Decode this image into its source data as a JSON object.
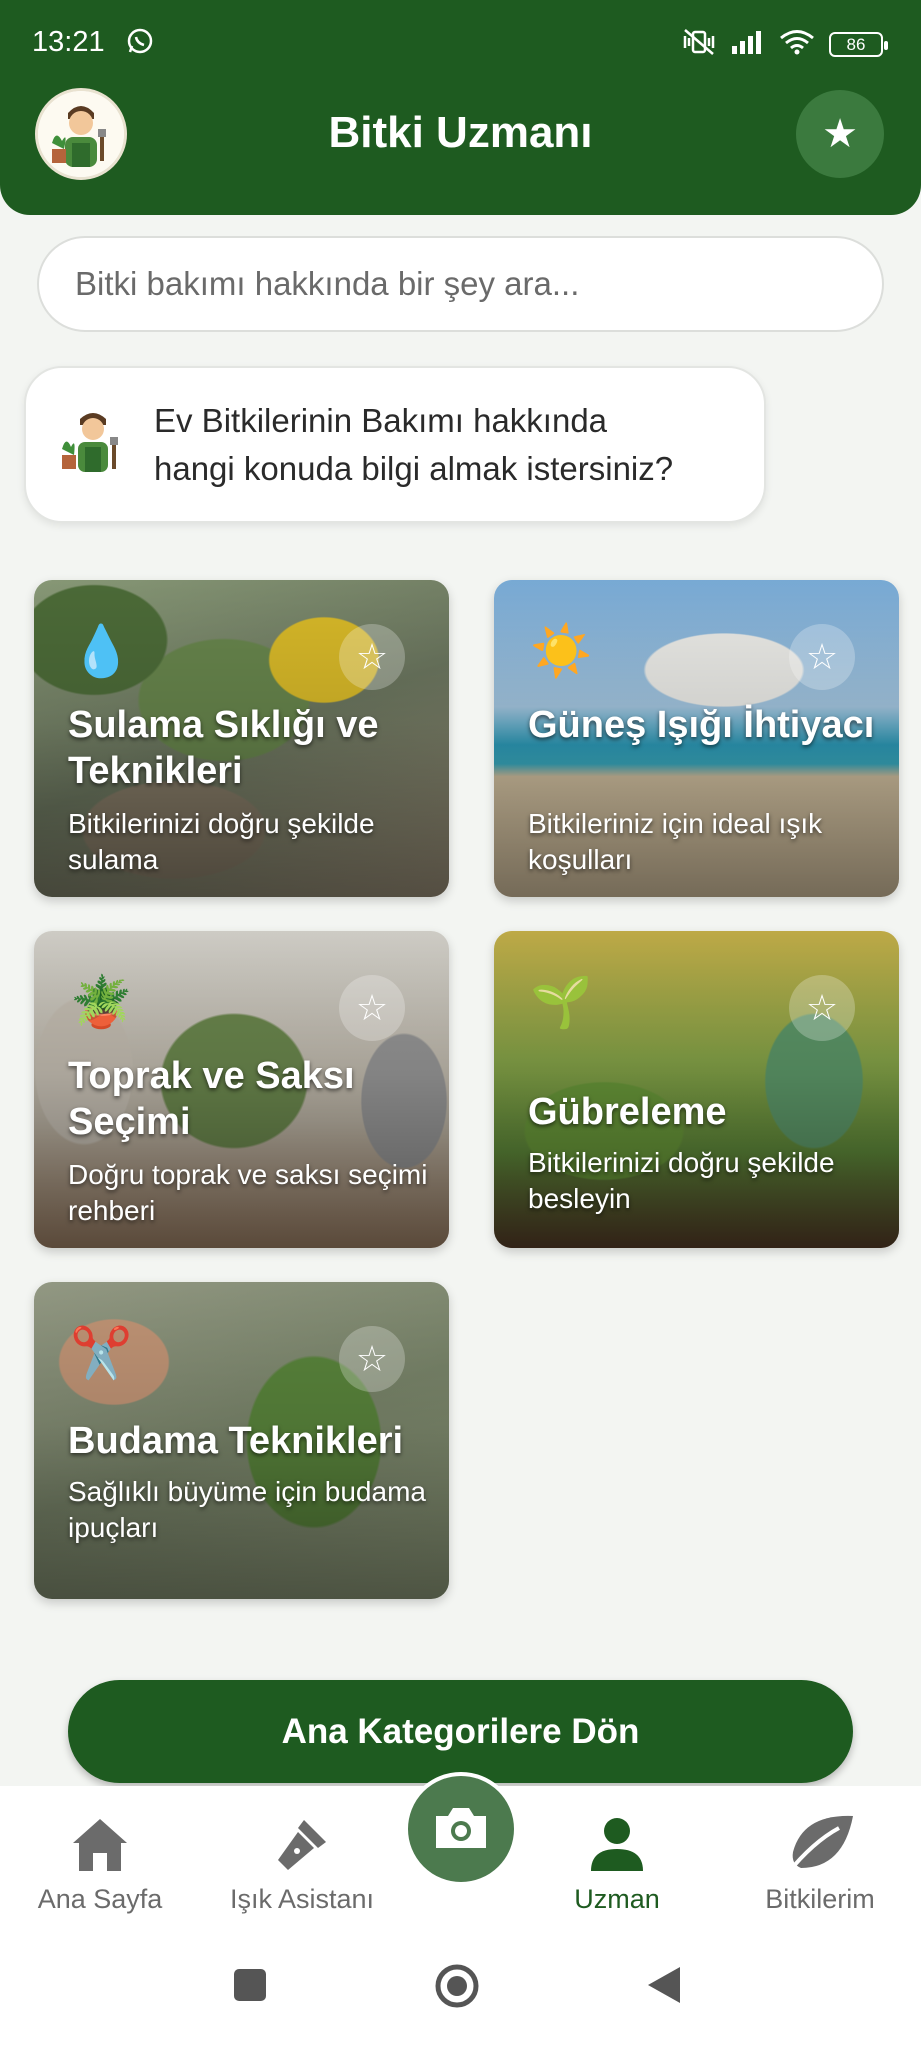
{
  "status_bar": {
    "time": "13:21",
    "battery": "86"
  },
  "header": {
    "title": "Bitki Uzmanı"
  },
  "search": {
    "placeholder": "Bitki bakımı hakkında bir şey ara..."
  },
  "bubble": {
    "line1": "Ev Bitkilerinin Bakımı hakkında",
    "line2": "hangi konuda bilgi almak istersiniz?"
  },
  "cards": [
    {
      "icon": "💧",
      "title": "Sulama Sıklığı ve Teknikleri",
      "subtitle": "Bitkilerinizi doğru şekilde sulama"
    },
    {
      "icon": "☀️",
      "title": "Güneş Işığı İhtiyacı",
      "subtitle": "Bitkileriniz için ideal ışık koşulları"
    },
    {
      "icon": "🪴",
      "title": "Toprak ve Saksı Seçimi",
      "subtitle": "Doğru toprak ve saksı seçimi rehberi"
    },
    {
      "icon": "🌱",
      "title": "Gübreleme",
      "subtitle": "Bitkilerinizi doğru şekilde besleyin"
    },
    {
      "icon": "✂️",
      "title": "Budama Teknikleri",
      "subtitle": "Sağlıklı büyüme için budama ipuçları"
    }
  ],
  "back_button": {
    "label": "Ana Kategorilere Dön"
  },
  "nav": {
    "items": [
      {
        "label": "Ana Sayfa",
        "icon": "home-icon"
      },
      {
        "label": "Işık Asistanı",
        "icon": "flashlight-icon"
      },
      {
        "label": "Uzman",
        "icon": "person-icon",
        "active": true
      },
      {
        "label": "Bitkilerim",
        "icon": "leaf-icon"
      }
    ]
  },
  "colors": {
    "primary": "#1e5b20",
    "camera": "#4c7a4e",
    "background": "#f3f5f2"
  }
}
